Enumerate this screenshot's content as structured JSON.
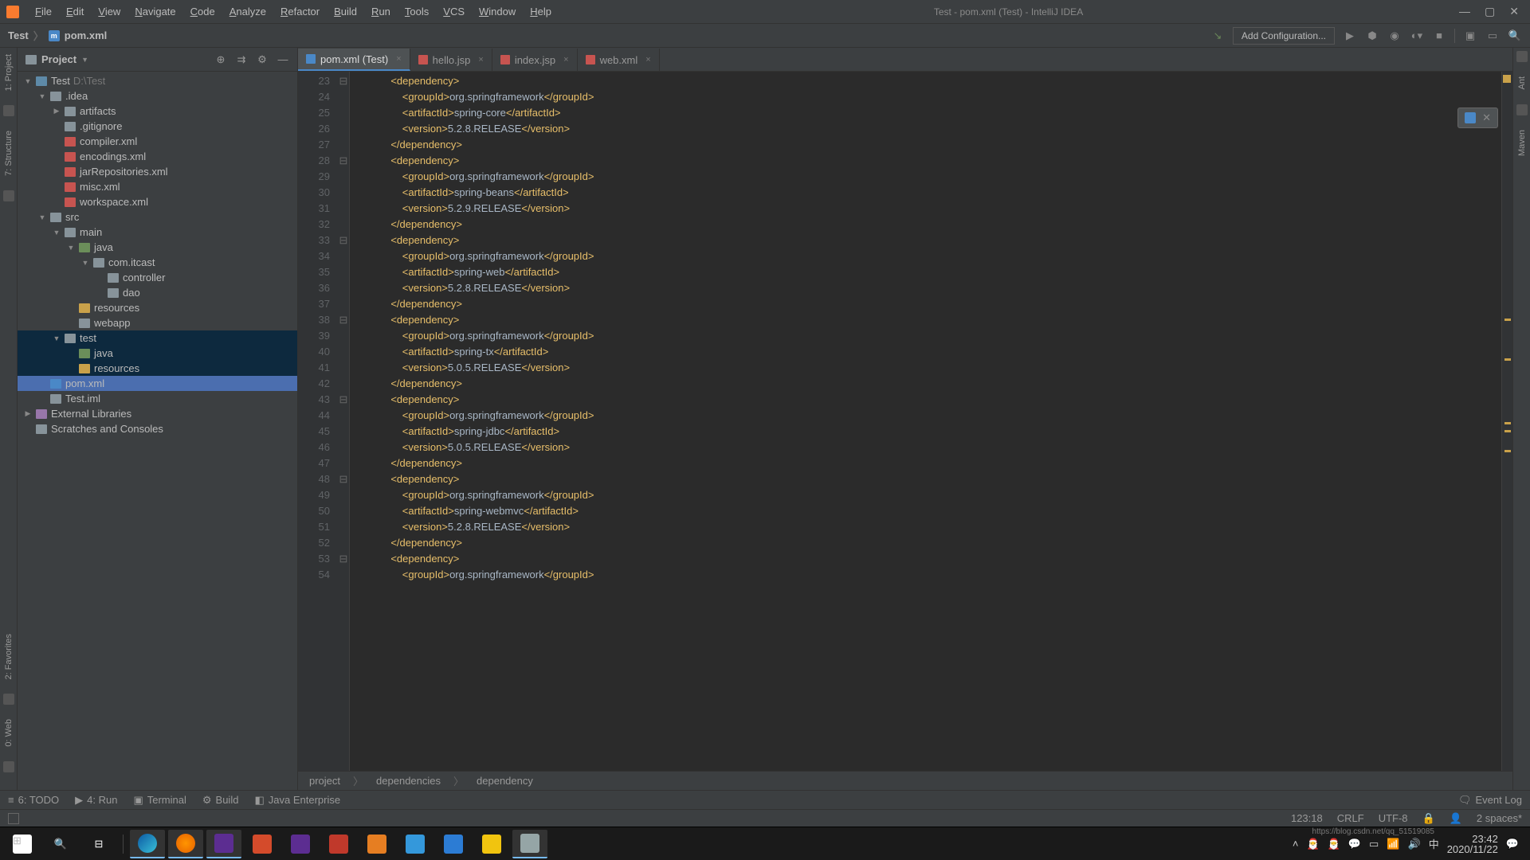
{
  "window": {
    "title": "Test - pom.xml (Test) - IntelliJ IDEA"
  },
  "menu": [
    "File",
    "Edit",
    "View",
    "Navigate",
    "Code",
    "Analyze",
    "Refactor",
    "Build",
    "Run",
    "Tools",
    "VCS",
    "Window",
    "Help"
  ],
  "breadcrumb": {
    "root": "Test",
    "file": "pom.xml"
  },
  "toolbar": {
    "add_config": "Add Configuration..."
  },
  "projectPanel": {
    "title": "Project"
  },
  "tree": [
    {
      "depth": 0,
      "arrow": "▼",
      "icon": "ic-module",
      "label": "Test",
      "suffix": "D:\\Test"
    },
    {
      "depth": 1,
      "arrow": "▼",
      "icon": "ic-folder",
      "label": ".idea"
    },
    {
      "depth": 2,
      "arrow": "▶",
      "icon": "ic-folder",
      "label": "artifacts"
    },
    {
      "depth": 2,
      "arrow": "",
      "icon": "ic-file",
      "label": ".gitignore"
    },
    {
      "depth": 2,
      "arrow": "",
      "icon": "ic-xml",
      "label": "compiler.xml"
    },
    {
      "depth": 2,
      "arrow": "",
      "icon": "ic-xml",
      "label": "encodings.xml"
    },
    {
      "depth": 2,
      "arrow": "",
      "icon": "ic-xml",
      "label": "jarRepositories.xml"
    },
    {
      "depth": 2,
      "arrow": "",
      "icon": "ic-xml",
      "label": "misc.xml"
    },
    {
      "depth": 2,
      "arrow": "",
      "icon": "ic-xml",
      "label": "workspace.xml"
    },
    {
      "depth": 1,
      "arrow": "▼",
      "icon": "ic-folder",
      "label": "src"
    },
    {
      "depth": 2,
      "arrow": "▼",
      "icon": "ic-folder",
      "label": "main"
    },
    {
      "depth": 3,
      "arrow": "▼",
      "icon": "ic-java",
      "label": "java"
    },
    {
      "depth": 4,
      "arrow": "▼",
      "icon": "ic-pkg",
      "label": "com.itcast"
    },
    {
      "depth": 5,
      "arrow": "",
      "icon": "ic-pkg",
      "label": "controller"
    },
    {
      "depth": 5,
      "arrow": "",
      "icon": "ic-pkg",
      "label": "dao"
    },
    {
      "depth": 3,
      "arrow": "",
      "icon": "ic-res",
      "label": "resources"
    },
    {
      "depth": 3,
      "arrow": "",
      "icon": "ic-folder",
      "label": "webapp"
    },
    {
      "depth": 2,
      "arrow": "▼",
      "icon": "ic-folder",
      "label": "test",
      "soft": true
    },
    {
      "depth": 3,
      "arrow": "",
      "icon": "ic-java",
      "label": "java",
      "soft": true
    },
    {
      "depth": 3,
      "arrow": "",
      "icon": "ic-res",
      "label": "resources",
      "soft": true
    },
    {
      "depth": 1,
      "arrow": "",
      "icon": "ic-m",
      "label": "pom.xml",
      "selected": true
    },
    {
      "depth": 1,
      "arrow": "",
      "icon": "ic-file",
      "label": "Test.iml"
    },
    {
      "depth": 0,
      "arrow": "▶",
      "icon": "ic-lib",
      "label": "External Libraries"
    },
    {
      "depth": 0,
      "arrow": "",
      "icon": "ic-folder",
      "label": "Scratches and Consoles"
    }
  ],
  "tabs": [
    {
      "label": "pom.xml (Test)",
      "icon": "ic-m",
      "active": true
    },
    {
      "label": "hello.jsp",
      "icon": "ic-xml"
    },
    {
      "label": "index.jsp",
      "icon": "ic-xml"
    },
    {
      "label": "web.xml",
      "icon": "ic-xml"
    }
  ],
  "editor": {
    "firstLine": 23,
    "lines": [
      [
        [
          "            ",
          "i"
        ],
        [
          "<dependency>",
          "t"
        ]
      ],
      [
        [
          "                ",
          "i"
        ],
        [
          "<groupId>",
          "t"
        ],
        [
          "org.springframework",
          "x"
        ],
        [
          "</groupId>",
          "t"
        ]
      ],
      [
        [
          "                ",
          "i"
        ],
        [
          "<artifactId>",
          "t"
        ],
        [
          "spring-core",
          "x"
        ],
        [
          "</artifactId>",
          "t"
        ]
      ],
      [
        [
          "                ",
          "i"
        ],
        [
          "<version>",
          "t"
        ],
        [
          "5.2.8.RELEASE",
          "x"
        ],
        [
          "</version>",
          "t"
        ]
      ],
      [
        [
          "            ",
          "i"
        ],
        [
          "</dependency>",
          "t"
        ]
      ],
      [
        [
          "            ",
          "i"
        ],
        [
          "<dependency>",
          "t"
        ]
      ],
      [
        [
          "                ",
          "i"
        ],
        [
          "<groupId>",
          "t"
        ],
        [
          "org.springframework",
          "x"
        ],
        [
          "</groupId>",
          "t"
        ]
      ],
      [
        [
          "                ",
          "i"
        ],
        [
          "<artifactId>",
          "t"
        ],
        [
          "spring-beans",
          "x"
        ],
        [
          "</artifactId>",
          "t"
        ]
      ],
      [
        [
          "                ",
          "i"
        ],
        [
          "<version>",
          "t"
        ],
        [
          "5.2.9.RELEASE",
          "x"
        ],
        [
          "</version>",
          "t"
        ]
      ],
      [
        [
          "            ",
          "i"
        ],
        [
          "</dependency>",
          "t"
        ]
      ],
      [
        [
          "            ",
          "i"
        ],
        [
          "<dependency>",
          "t"
        ]
      ],
      [
        [
          "                ",
          "i"
        ],
        [
          "<groupId>",
          "t"
        ],
        [
          "org.springframework",
          "x"
        ],
        [
          "</groupId>",
          "t"
        ]
      ],
      [
        [
          "                ",
          "i"
        ],
        [
          "<artifactId>",
          "t"
        ],
        [
          "spring-web",
          "x"
        ],
        [
          "</artifactId>",
          "t"
        ]
      ],
      [
        [
          "                ",
          "i"
        ],
        [
          "<version>",
          "t"
        ],
        [
          "5.2.8.RELEASE",
          "x"
        ],
        [
          "</version>",
          "t"
        ]
      ],
      [
        [
          "            ",
          "i"
        ],
        [
          "</dependency>",
          "t"
        ]
      ],
      [
        [
          "            ",
          "i"
        ],
        [
          "<dependency>",
          "t"
        ]
      ],
      [
        [
          "                ",
          "i"
        ],
        [
          "<groupId>",
          "t"
        ],
        [
          "org.springframework",
          "x"
        ],
        [
          "</groupId>",
          "t"
        ]
      ],
      [
        [
          "                ",
          "i"
        ],
        [
          "<artifactId>",
          "t"
        ],
        [
          "spring-tx",
          "x"
        ],
        [
          "</artifactId>",
          "t"
        ]
      ],
      [
        [
          "                ",
          "i"
        ],
        [
          "<version>",
          "t"
        ],
        [
          "5.0.5.RELEASE",
          "x"
        ],
        [
          "</version>",
          "t"
        ]
      ],
      [
        [
          "            ",
          "i"
        ],
        [
          "</dependency>",
          "t"
        ]
      ],
      [
        [
          "            ",
          "i"
        ],
        [
          "<dependency>",
          "t"
        ]
      ],
      [
        [
          "                ",
          "i"
        ],
        [
          "<groupId>",
          "t"
        ],
        [
          "org.springframework",
          "x"
        ],
        [
          "</groupId>",
          "t"
        ]
      ],
      [
        [
          "                ",
          "i"
        ],
        [
          "<artifactId>",
          "t"
        ],
        [
          "spring-jdbc",
          "x"
        ],
        [
          "</artifactId>",
          "t"
        ]
      ],
      [
        [
          "                ",
          "i"
        ],
        [
          "<version>",
          "t"
        ],
        [
          "5.0.5.RELEASE",
          "x"
        ],
        [
          "</version>",
          "t"
        ]
      ],
      [
        [
          "            ",
          "i"
        ],
        [
          "</dependency>",
          "t"
        ]
      ],
      [
        [
          "            ",
          "i"
        ],
        [
          "<dependency>",
          "t"
        ]
      ],
      [
        [
          "                ",
          "i"
        ],
        [
          "<groupId>",
          "t"
        ],
        [
          "org.springframework",
          "x"
        ],
        [
          "</groupId>",
          "t"
        ]
      ],
      [
        [
          "                ",
          "i"
        ],
        [
          "<artifactId>",
          "t"
        ],
        [
          "spring-webmvc",
          "x"
        ],
        [
          "</artifactId>",
          "t"
        ]
      ],
      [
        [
          "                ",
          "i"
        ],
        [
          "<version>",
          "t"
        ],
        [
          "5.2.8.RELEASE",
          "x"
        ],
        [
          "</version>",
          "t"
        ]
      ],
      [
        [
          "            ",
          "i"
        ],
        [
          "</dependency>",
          "t"
        ]
      ],
      [
        [
          "            ",
          "i"
        ],
        [
          "<dependency>",
          "t"
        ]
      ],
      [
        [
          "                ",
          "i"
        ],
        [
          "<groupId>",
          "t"
        ],
        [
          "org.springframework",
          "x"
        ],
        [
          "</groupId>",
          "t"
        ]
      ]
    ],
    "foldMarks": [
      0,
      5,
      10,
      15,
      20,
      25,
      30
    ],
    "crumbs": [
      "project",
      "dependencies",
      "dependency"
    ]
  },
  "bottomTools": [
    {
      "icon": "≡",
      "label": "6: TODO"
    },
    {
      "icon": "▶",
      "label": "4: Run"
    },
    {
      "icon": "▣",
      "label": "Terminal"
    },
    {
      "icon": "⚙",
      "label": "Build"
    },
    {
      "icon": "◧",
      "label": "Java Enterprise"
    }
  ],
  "eventLog": "Event Log",
  "status": {
    "pos": "123:18",
    "sep": "CRLF",
    "enc": "UTF-8",
    "indent": "2 spaces*"
  },
  "leftGutter": [
    "1: Project",
    "7: Structure"
  ],
  "leftGutterBottom": [
    "2: Favorites",
    "0: Web"
  ],
  "rightGutter": [
    "Ant",
    "Maven"
  ],
  "taskbar": {
    "time": "23:42",
    "date": "2020/11/22",
    "watermark": "https://blog.csdn.net/qq_51519085"
  }
}
